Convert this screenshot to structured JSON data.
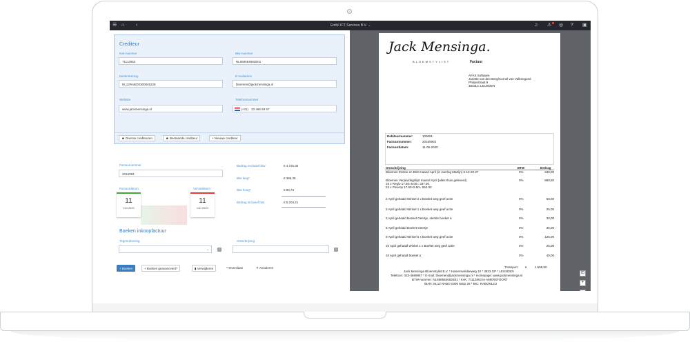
{
  "topbar": {
    "company": "Enthil ICT Services B.V.",
    "icons": [
      "menu-icon",
      "home-icon",
      "back-icon",
      "bell-icon",
      "warning-icon",
      "check-circle-icon",
      "help-icon",
      "window-icon"
    ]
  },
  "crediteur": {
    "title": "Crediteur",
    "kvk_label": "Kvk-nummer",
    "kvk_value": "71112653",
    "btw_label": "Btw-nummer",
    "btw_value": "NL858584682B01",
    "bank_label": "Bankrekening",
    "bank_value": "NL12RABO0300845228",
    "email_label": "E-mailadres",
    "email_value": "bloemen@jackmensinga.nl",
    "website_label": "Website",
    "website_value": "www.jackmensinga.nl",
    "phone_label": "Telefoonnummer",
    "phone_prefix": "(+31)",
    "phone_value": "33 466 69 57",
    "buttons": {
      "diverse": "Diverse crediteuren",
      "bestaande": "Bestaande crediteur",
      "nieuwe": "+ Nieuwe crediteur"
    }
  },
  "factuur": {
    "nummer_label": "Factuurnummer",
    "nummer_value": "2016393",
    "datum_label": "Factuurdatum",
    "datum_day": "11",
    "datum_month": "mei 2020",
    "verval_label": "Vervaldatum",
    "verval_day": "11",
    "verval_month": "mei 2020",
    "excl_label": "Bedrag exclusief btw",
    "excl_value": "€ 4.726,30",
    "btw_laag_label": "Btw laag*",
    "btw_laag_value": "€ 386,35",
    "btw_hoog_label": "Btw hoog*",
    "btw_hoog_value": "€ 90,73",
    "incl_label": "Bedrag inclusief btw",
    "incl_value": "€ 5.204,21"
  },
  "boeken": {
    "title": "Boeken inkoopfactuur",
    "tegen_label": "Tegenrekening",
    "omschrijving_label": "Omschrijving",
    "actions": {
      "boeken": "+ Boeken",
      "geavanceerd": "+ Boeken geavanceerd*",
      "verwijderen": "Verwijderen",
      "overslaan": "Overslaan",
      "annuleren": "Annuleren"
    }
  },
  "document": {
    "logo_text": "Jack Mensinga.",
    "logo_sub": "BLOEMSTYLIST",
    "heading": "Factuur",
    "address": [
      "AFAS Software",
      "Janette van den Berg/Cornel van Valkengoed",
      "Philipsstraat 9",
      "3833LC  LEUSDEN"
    ],
    "meta": [
      {
        "label": "Debiteurnummer:",
        "value": "100061"
      },
      {
        "label": "Factuurnummer:",
        "value": "20160903"
      },
      {
        "label": "Factuurdatum:",
        "value": "11-05-2020"
      }
    ],
    "col_omschrijving": "Omschrijving",
    "col_btw": "BTW",
    "col_bedrag": "Bedrag",
    "lines": [
      {
        "desc": "Bloemen Entree en Britt maand April (in overleg Martijn) 6-13-20-27",
        "btw": "0%",
        "amount": "340,00"
      },
      {
        "desc": "Bloemen Verjaardagslijst maand April (alles thuis geleverd)\n15 x Regio 17.50=5.00= 337.50\n23 x Fleurop 17.50+8.50= 552.00",
        "btw": "0%",
        "amount": "889,50"
      },
      {
        "desc": "2 April gehaald Winkel 2 x Boeket weg geef actie",
        "btw": "0%",
        "amount": "50,00"
      },
      {
        "desc": "3 April gehaald Winkel 1 x Boeket weg geef actie",
        "btw": "0%",
        "amount": "25,00"
      },
      {
        "desc": "3 April gehaald Boeket Geertje, sterkte boeket a",
        "btw": "0%",
        "amount": "30,00"
      },
      {
        "desc": "8 April gehaald Boeket Geertje",
        "btw": "0%",
        "amount": "35,00"
      },
      {
        "desc": "9 April gehaald Winkel 5 x Boeket weg geef actie",
        "btw": "0%",
        "amount": "125,00"
      },
      {
        "desc": "10 April gehaald Winkel 1 x Boeket weg geef actie",
        "btw": "0%",
        "amount": "25,00"
      },
      {
        "desc": "10 April gehaald Boeket a",
        "btw": "0%",
        "amount": "40,00"
      }
    ],
    "transport_label": "Transport",
    "transport_currency": "€",
    "transport_value": "1.558,50",
    "footer": [
      "Jack Mensinga Bloemstylist B.V. * Hamersveldseweg 10 * 3833 GP * LEUSDEN",
      "Telefoon: 033-4699957 * E-mail: bloemen@jackmensinga.nl * Homepage: www.jackmensinga.nl",
      "BTW-nummer: NL858584682B01 * KvK: 71112653 te AMERSFOORT",
      "IBAN: NL12 RABO 0300 8452 28 * BIC: RABONL2U"
    ]
  },
  "zoom": {
    "fit": "⊡",
    "plus": "+",
    "minus": "−"
  }
}
